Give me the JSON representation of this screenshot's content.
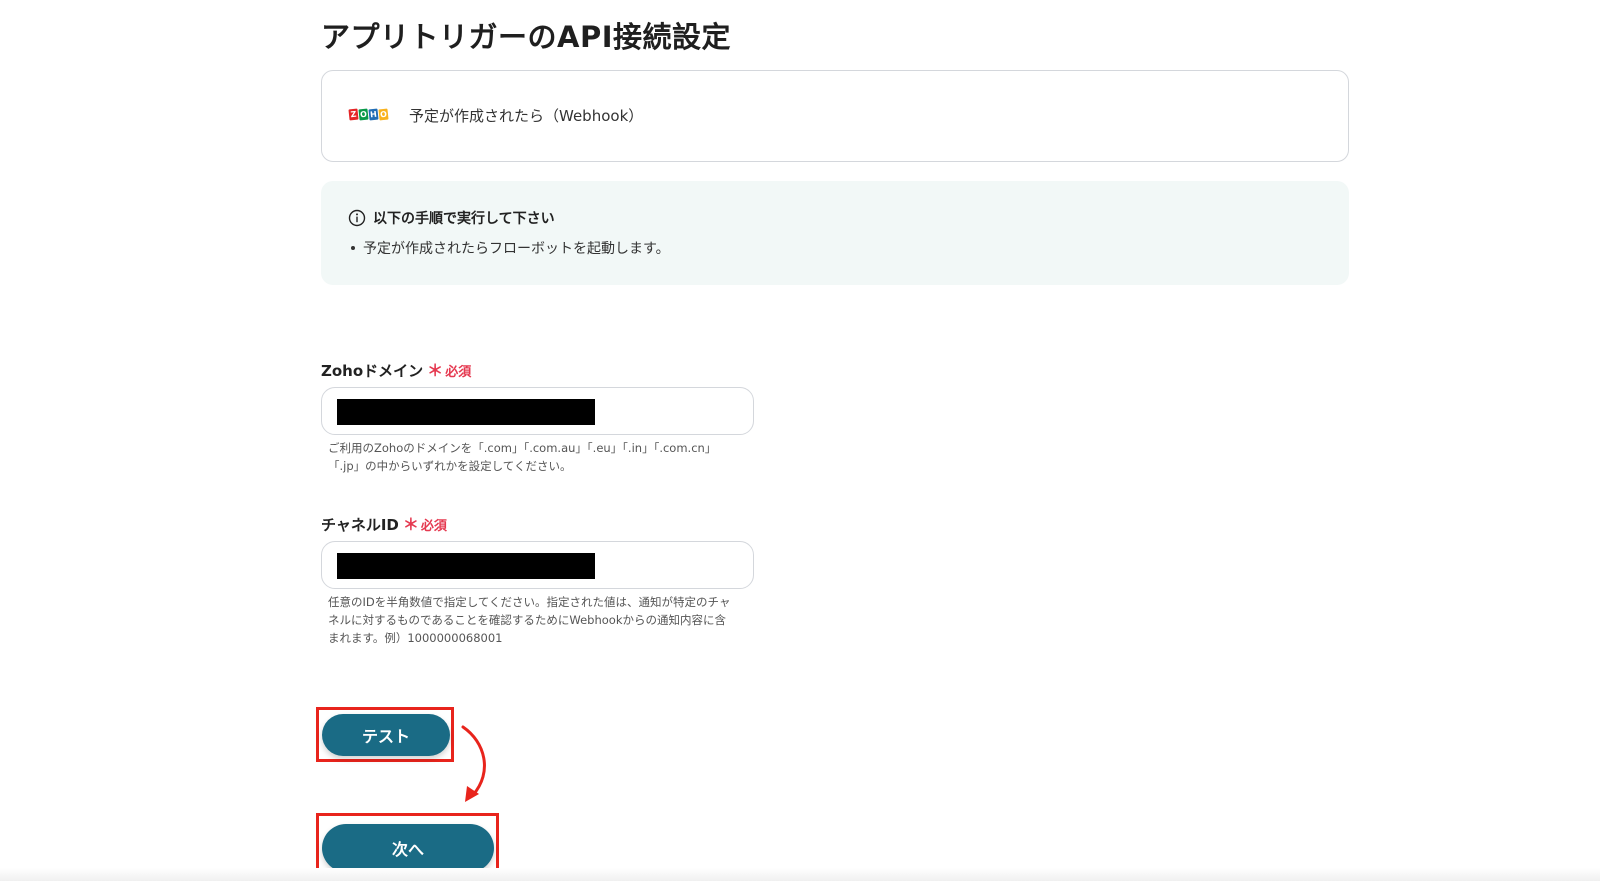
{
  "page": {
    "title": "アプリトリガーのAPI接続設定"
  },
  "trigger": {
    "app_logo": "zoho-logo",
    "logo_letters": [
      "Z",
      "O",
      "H",
      "O"
    ],
    "logo_colors": [
      "#e42527",
      "#089949",
      "#226db4",
      "#f9b21d"
    ],
    "label": "予定が作成されたら（Webhook）"
  },
  "info": {
    "icon": "info-icon",
    "heading": "以下の手順で実行して下さい",
    "items": [
      "予定が作成されたらフローボットを起動します。"
    ],
    "background_color": "#f2f8f7"
  },
  "fields": {
    "zoho_domain": {
      "label": "Zohoドメイン",
      "required_mark": "＊",
      "required_text": "必須",
      "value_redacted": true,
      "help_line1": "ご利用のZohoのドメインを「.com」「.com.au」「.eu」「.in」「.com.cn」",
      "help_line2": "「.jp」の中からいずれかを設定してください。"
    },
    "channel_id": {
      "label": "チャネルID",
      "required_mark": "＊",
      "required_text": "必須",
      "value_redacted": true,
      "help_line1": "任意のIDを半角数値で指定してください。指定された値は、通知が特定のチャ",
      "help_line2": "ネルに対するものであることを確認するためにWebhookからの通知内容に含",
      "help_line3": "まれます。例）1000000068001"
    }
  },
  "buttons": {
    "test_label": "テスト",
    "next_label": "次へ",
    "color": "#1a6b85"
  },
  "annotation": {
    "highlight_color": "#e8241c",
    "arrow": "curved-arrow"
  }
}
